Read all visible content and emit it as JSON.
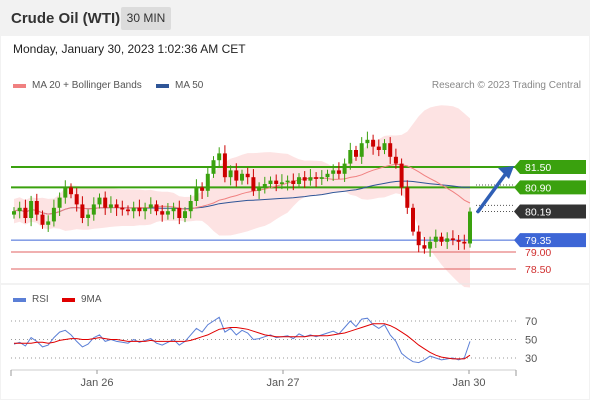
{
  "header": {
    "instrument": "Crude Oil (WTI)",
    "timeframe": "30 MIN"
  },
  "datetime": "Monday, January 30, 2023 1:02:36 AM CET",
  "legend": {
    "ma20_label": "MA 20 + Bollinger Bands",
    "ma50_label": "MA 50",
    "ma20_color": "#f08080",
    "ma50_color": "#2f5597"
  },
  "credit": "Research © 2023 Trading Central",
  "rsi_legend": {
    "rsi_label": "RSI",
    "ma_label": "9MA",
    "rsi_color": "#5b7fd6",
    "ma_color": "#e00000"
  },
  "colors": {
    "resistance": "#3aa10e",
    "pivot": "#3d66d6",
    "support": "#e06060",
    "up_candle": "#3aa10e",
    "down_candle": "#cc0000",
    "bands": "#fde3e3"
  },
  "chart_data": [
    {
      "type": "candlestick",
      "x_ticks": [
        "Jan 26",
        "Jan 27",
        "Jan 30"
      ],
      "y_range": [
        78.1,
        82.4
      ],
      "levels": [
        {
          "value": 81.5,
          "label": "81.50",
          "kind": "resistance",
          "badge": true
        },
        {
          "value": 80.9,
          "label": "80.90",
          "kind": "resistance",
          "badge": true
        },
        {
          "value": 80.19,
          "label": "80.19",
          "kind": "last",
          "badge": true
        },
        {
          "value": 79.35,
          "label": "79.35",
          "kind": "pivot",
          "badge": true
        },
        {
          "value": 79.0,
          "label": "79.00",
          "kind": "support",
          "badge": false
        },
        {
          "value": 78.5,
          "label": "78.50",
          "kind": "support",
          "badge": false
        }
      ],
      "series": [
        {
          "name": "MA 20 + Bollinger Bands",
          "kind": "ma20"
        },
        {
          "name": "MA 50",
          "kind": "ma50"
        }
      ],
      "close": [
        80.2,
        80.3,
        80.0,
        80.5,
        80.1,
        79.8,
        79.9,
        80.3,
        80.6,
        80.9,
        80.7,
        80.4,
        80.0,
        80.1,
        80.4,
        80.6,
        80.3,
        80.4,
        80.3,
        80.25,
        80.2,
        80.3,
        80.2,
        80.3,
        80.4,
        80.2,
        80.1,
        80.2,
        80.3,
        80.0,
        80.2,
        80.5,
        80.9,
        80.8,
        81.3,
        81.7,
        81.9,
        81.2,
        81.4,
        81.1,
        81.3,
        81.2,
        80.8,
        80.9,
        81.0,
        81.1,
        81.0,
        81.05,
        81.1,
        81.0,
        81.2,
        81.1,
        81.2,
        81.15,
        81.2,
        81.3,
        81.4,
        81.3,
        81.6,
        82.0,
        81.8,
        82.2,
        82.3,
        82.1,
        82.0,
        82.2,
        81.8,
        81.6,
        80.9,
        80.3,
        79.6,
        79.2,
        79.1,
        79.3,
        79.45,
        79.3,
        79.4,
        79.35,
        79.3,
        79.25,
        80.19
      ]
    },
    {
      "type": "line",
      "name": "RSI",
      "y_ticks": [
        70,
        50,
        30
      ],
      "y_range": [
        14,
        86
      ],
      "series": [
        {
          "name": "RSI",
          "values": [
            45,
            47,
            43,
            52,
            48,
            42,
            44,
            52,
            58,
            60,
            55,
            48,
            42,
            45,
            52,
            55,
            48,
            50,
            48,
            47,
            46,
            50,
            47,
            49,
            51,
            46,
            44,
            47,
            50,
            44,
            48,
            55,
            62,
            58,
            66,
            70,
            74,
            58,
            62,
            55,
            60,
            57,
            50,
            51,
            53,
            55,
            52,
            53,
            54,
            51,
            56,
            53,
            55,
            53,
            55,
            57,
            59,
            56,
            63,
            70,
            64,
            72,
            73,
            66,
            62,
            66,
            55,
            48,
            35,
            30,
            26,
            25,
            28,
            32,
            30,
            28,
            29,
            30,
            28,
            30,
            48
          ]
        },
        {
          "name": "9MA",
          "values": [
            46,
            46,
            46,
            46,
            47,
            47,
            46,
            47,
            49,
            50,
            51,
            51,
            50,
            50,
            51,
            52,
            51,
            50,
            50,
            49,
            48,
            48,
            48,
            48,
            49,
            48,
            48,
            48,
            48,
            48,
            48,
            49,
            51,
            53,
            55,
            58,
            61,
            62,
            63,
            63,
            62,
            61,
            59,
            57,
            55,
            54,
            53,
            53,
            53,
            53,
            53,
            53,
            54,
            54,
            54,
            54,
            55,
            56,
            57,
            59,
            61,
            63,
            65,
            67,
            67,
            67,
            65,
            62,
            58,
            54,
            49,
            44,
            40,
            36,
            33,
            31,
            30,
            29,
            29,
            29,
            33
          ]
        }
      ]
    }
  ]
}
